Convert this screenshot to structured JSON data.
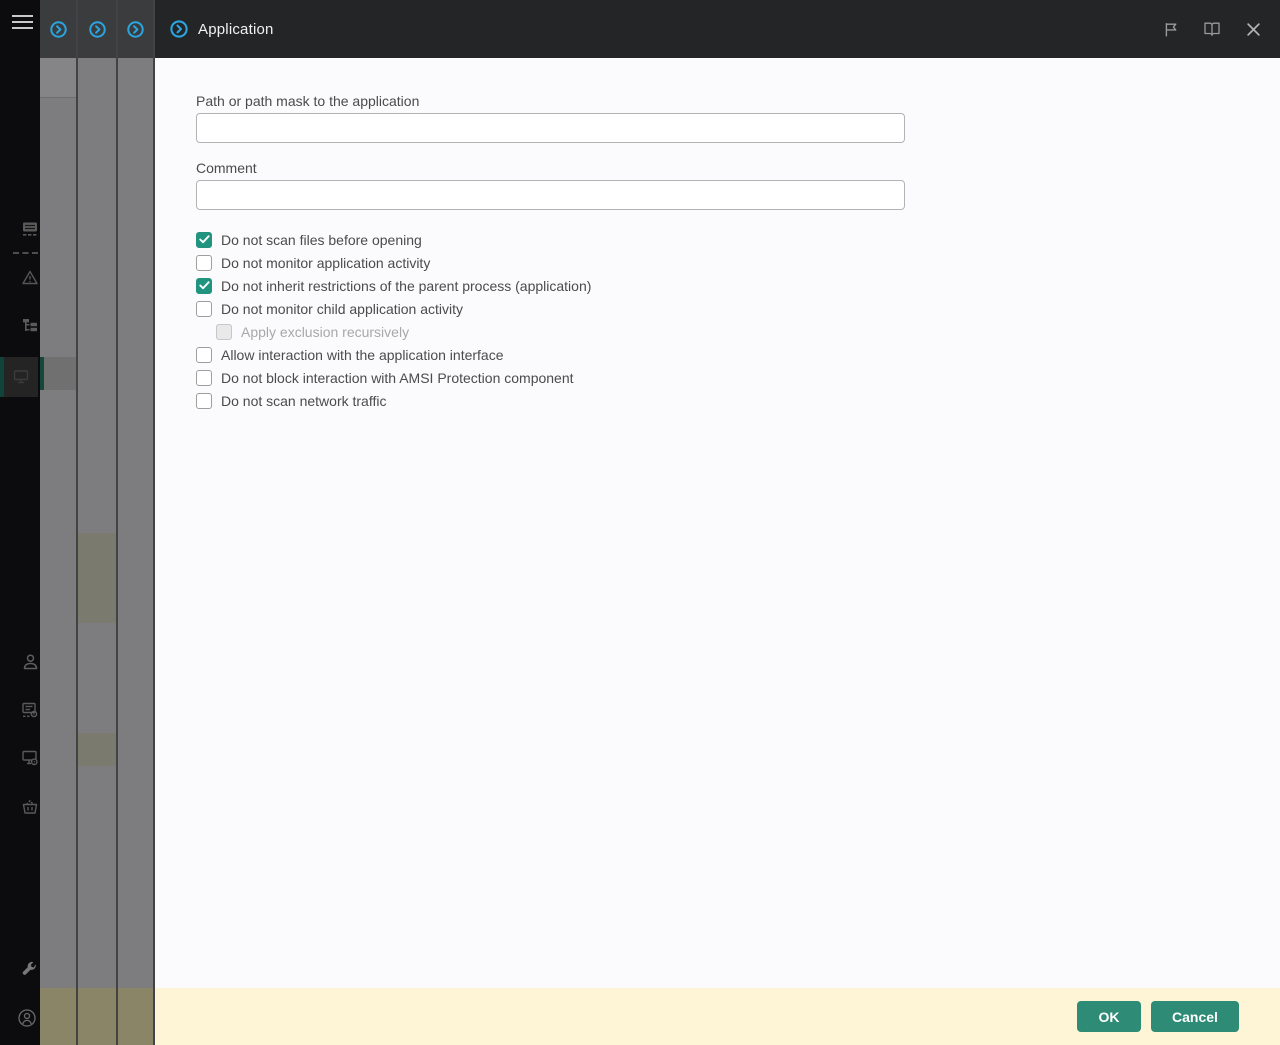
{
  "header": {
    "title": "Application",
    "right_icons": [
      "flag-icon",
      "book-icon",
      "close-icon"
    ]
  },
  "stacked_panels": {
    "count": 3,
    "tab_icon": "circle-chevron-icon"
  },
  "sidebar": {
    "items": [
      {
        "name": "menu-icon"
      },
      {
        "name": "monitoring-icon"
      },
      {
        "name": "alerts-icon"
      },
      {
        "name": "hierarchy-icon"
      },
      {
        "name": "devices-icon",
        "selected": true
      },
      {
        "name": "users-icon"
      },
      {
        "name": "policies-icon"
      },
      {
        "name": "device-settings-icon"
      },
      {
        "name": "marketplace-icon"
      },
      {
        "name": "console-settings-icon"
      },
      {
        "name": "account-icon"
      }
    ]
  },
  "form": {
    "path": {
      "label": "Path or path mask to the application",
      "value": ""
    },
    "comment": {
      "label": "Comment",
      "value": ""
    }
  },
  "checkboxes": [
    {
      "label": "Do not scan files before opening",
      "checked": true,
      "disabled": false,
      "indent": false
    },
    {
      "label": "Do not monitor application activity",
      "checked": false,
      "disabled": false,
      "indent": false
    },
    {
      "label": "Do not inherit restrictions of the parent process (application)",
      "checked": true,
      "disabled": false,
      "indent": false
    },
    {
      "label": "Do not monitor child application activity",
      "checked": false,
      "disabled": false,
      "indent": false
    },
    {
      "label": "Apply exclusion recursively",
      "checked": false,
      "disabled": true,
      "indent": true
    },
    {
      "label": "Allow interaction with the application interface",
      "checked": false,
      "disabled": false,
      "indent": false
    },
    {
      "label": "Do not block interaction with AMSI Protection component",
      "checked": false,
      "disabled": false,
      "indent": false
    },
    {
      "label": "Do not scan network traffic",
      "checked": false,
      "disabled": false,
      "indent": false
    }
  ],
  "footer": {
    "ok": "OK",
    "cancel": "Cancel"
  },
  "colors": {
    "accent_blue": "#2aa5e0",
    "checkbox_teal": "#21947f",
    "button_green": "#2e8b76",
    "footer_yellow": "#fdf5d6",
    "header_dark": "#232527",
    "sidebar_black": "#0c0c0e",
    "overlay_gray": "#7d7d7f"
  }
}
